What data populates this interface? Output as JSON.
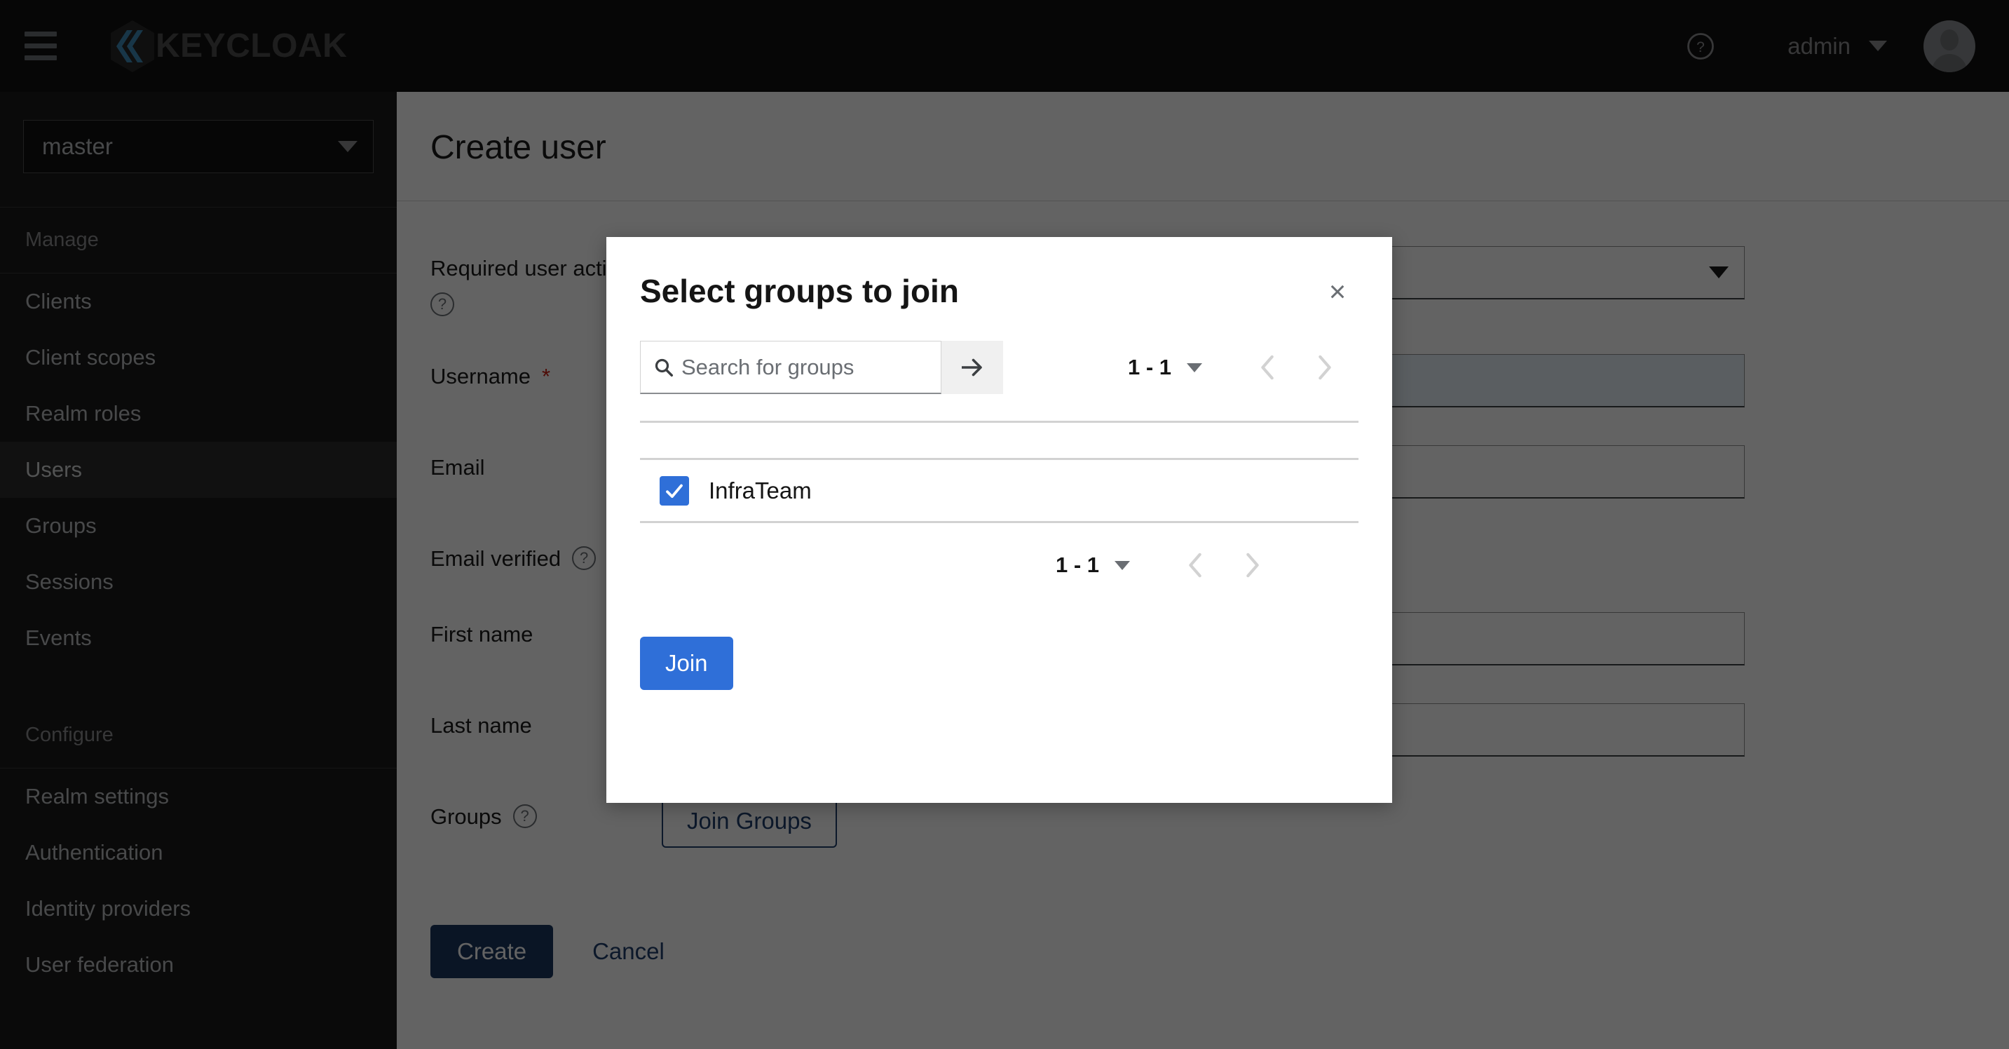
{
  "masthead": {
    "hamburger_icon": "hamburger-menu-icon",
    "brand_name": "KEYCLOAK",
    "help_icon": "help-circle-icon",
    "user_name": "admin",
    "user_caret_icon": "chevron-down-icon",
    "avatar_icon": "user-avatar-icon"
  },
  "sidebar": {
    "realm_selected": "master",
    "realm_caret_icon": "caret-down-icon",
    "sections": [
      {
        "label": "Manage",
        "items": [
          {
            "label": "Clients",
            "active": false
          },
          {
            "label": "Client scopes",
            "active": false
          },
          {
            "label": "Realm roles",
            "active": false
          },
          {
            "label": "Users",
            "active": true
          },
          {
            "label": "Groups",
            "active": false
          },
          {
            "label": "Sessions",
            "active": false
          },
          {
            "label": "Events",
            "active": false
          }
        ]
      },
      {
        "label": "Configure",
        "items": [
          {
            "label": "Realm settings",
            "active": false
          },
          {
            "label": "Authentication",
            "active": false
          },
          {
            "label": "Identity providers",
            "active": false
          },
          {
            "label": "User federation",
            "active": false
          }
        ]
      }
    ]
  },
  "page": {
    "title": "Create user",
    "fields": [
      {
        "label": "Required user actions",
        "required": false,
        "help": true,
        "type": "select",
        "value": ""
      },
      {
        "label": "Username",
        "required": true,
        "help": false,
        "type": "text",
        "value": "",
        "focused": true
      },
      {
        "label": "Email",
        "required": false,
        "help": false,
        "type": "text",
        "value": ""
      },
      {
        "label": "Email verified",
        "required": false,
        "help": true,
        "type": "switch",
        "value": "off"
      },
      {
        "label": "First name",
        "required": false,
        "help": false,
        "type": "text",
        "value": ""
      },
      {
        "label": "Last name",
        "required": false,
        "help": false,
        "type": "text",
        "value": ""
      },
      {
        "label": "Groups",
        "required": false,
        "help": true,
        "type": "button",
        "value": "Join Groups"
      }
    ],
    "required_marker": "*",
    "help_glyph": "?",
    "create_label": "Create",
    "cancel_label": "Cancel"
  },
  "modal": {
    "title": "Select groups to join",
    "close_icon": "close-x-icon",
    "close_glyph": "×",
    "search": {
      "placeholder": "Search for groups",
      "value": "",
      "icon": "search-icon",
      "submit_icon": "arrow-right-icon"
    },
    "pagination_top": {
      "count": "1 - 1",
      "caret_icon": "caret-down-icon",
      "prev_icon": "chevron-left-icon",
      "next_icon": "chevron-right-icon"
    },
    "pagination_bottom": {
      "count": "1 - 1",
      "caret_icon": "caret-down-icon",
      "prev_icon": "chevron-left-icon",
      "next_icon": "chevron-right-icon"
    },
    "rows": [
      {
        "name": "InfraTeam",
        "checked": true,
        "check_icon": "checkmark-icon"
      }
    ],
    "join_label": "Join"
  },
  "colors": {
    "brand_accent": "#3b8ab8",
    "primary_blue": "#2f6fd8",
    "dark_blue": "#16325c",
    "link_blue": "#1b3a6b",
    "required_red": "#c9190b",
    "masthead_bg": "#0c0c0c",
    "sidebar_bg": "#151515",
    "sidebar_active_bg": "#292929",
    "focus_bg": "#e7f1fa"
  }
}
